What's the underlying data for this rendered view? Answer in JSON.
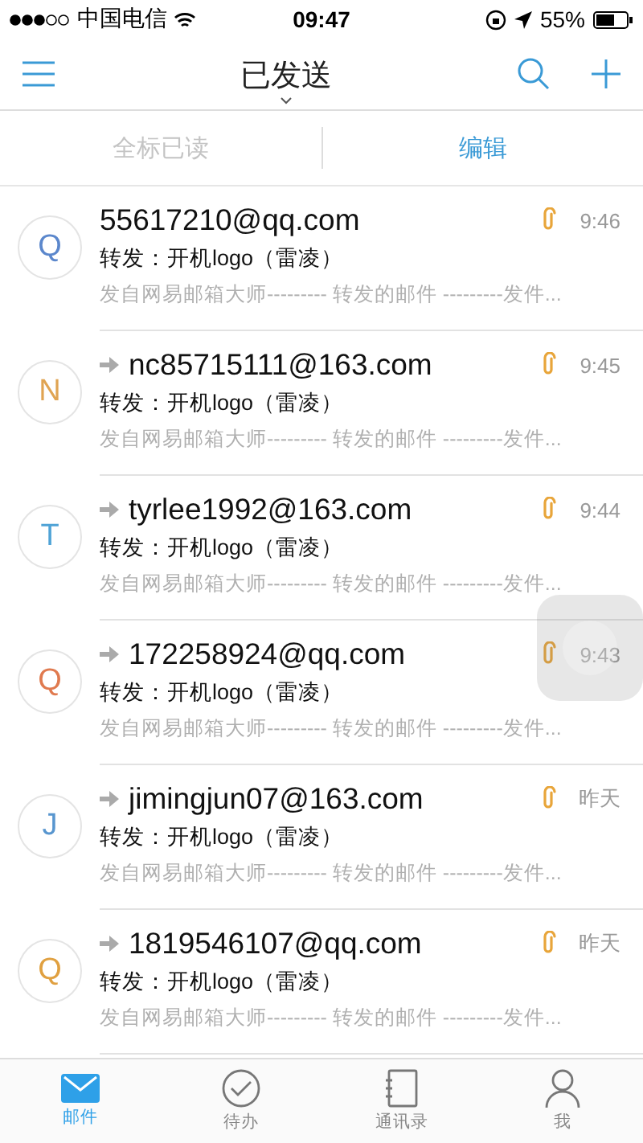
{
  "status_bar": {
    "carrier": "中国电信",
    "time": "09:47",
    "battery": "55%"
  },
  "nav": {
    "title": "已发送"
  },
  "actions": [
    {
      "label": "全标已读",
      "disabled": true
    },
    {
      "label": "编辑",
      "disabled": false
    }
  ],
  "messages": [
    {
      "avatar": "Q",
      "color": "#5b87cc",
      "sender": "55617210@qq.com",
      "forwarded": false,
      "attachment": true,
      "time": "9:46",
      "subject": "转发：开机logo（雷凌）",
      "preview": "发自网易邮箱大师--------- 转发的邮件 ---------发件..."
    },
    {
      "avatar": "N",
      "color": "#e0a452",
      "sender": "nc85715111@163.com",
      "forwarded": true,
      "attachment": true,
      "time": "9:45",
      "subject": "转发：开机logo（雷凌）",
      "preview": "发自网易邮箱大师--------- 转发的邮件 ---------发件..."
    },
    {
      "avatar": "T",
      "color": "#4fa3d6",
      "sender": "tyrlee1992@163.com",
      "forwarded": true,
      "attachment": true,
      "time": "9:44",
      "subject": "转发：开机logo（雷凌）",
      "preview": "发自网易邮箱大师--------- 转发的邮件 ---------发件..."
    },
    {
      "avatar": "Q",
      "color": "#e07a4f",
      "sender": "172258924@qq.com",
      "forwarded": true,
      "attachment": true,
      "time": "9:43",
      "subject": "转发：开机logo（雷凌）",
      "preview": "发自网易邮箱大师--------- 转发的邮件 ---------发件..."
    },
    {
      "avatar": "J",
      "color": "#5896cf",
      "sender": "jimingjun07@163.com",
      "forwarded": true,
      "attachment": true,
      "time": "昨天",
      "subject": "转发：开机logo（雷凌）",
      "preview": "发自网易邮箱大师--------- 转发的邮件 ---------发件..."
    },
    {
      "avatar": "Q",
      "color": "#e0a040",
      "sender": "1819546107@qq.com",
      "forwarded": true,
      "attachment": true,
      "time": "昨天",
      "subject": "转发：开机logo（雷凌）",
      "preview": "发自网易邮箱大师--------- 转发的邮件 ---------发件..."
    }
  ],
  "tabs": [
    {
      "kind": "mail",
      "label": "邮件",
      "selected": true
    },
    {
      "kind": "todo",
      "label": "待办",
      "selected": false
    },
    {
      "kind": "contacts",
      "label": "通讯录",
      "selected": false
    },
    {
      "kind": "me",
      "label": "我",
      "selected": false
    }
  ]
}
